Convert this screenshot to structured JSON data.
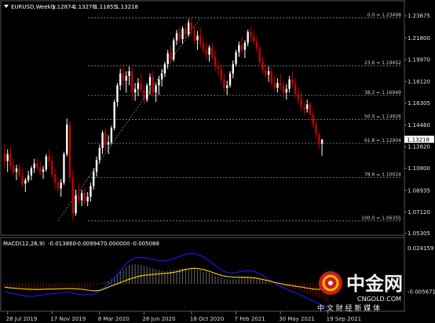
{
  "chart_header": {
    "symbol": "EURUSD,Weekly",
    "open": "1.12874",
    "high": "1.13278",
    "low": "1.11855",
    "close": "1.13218"
  },
  "macd_header": {
    "label": "MACD(12,26,9)",
    "macd": "-0.013860",
    "signal": "-0.009947",
    "hist": "0.000000",
    "extra": "-0.005088"
  },
  "current_price": "1.13218",
  "watermark": {
    "logo_text": "中金网",
    "domain": "CNGOLD.COM",
    "slogan": "中 文 财 经 新 媒 体"
  },
  "colors": {
    "background": "#000000",
    "bull": "#ffffff",
    "bear": "#cc0000",
    "fib_line": "#8c8c8c",
    "macd_hist_pos": "#d0d0d0",
    "macd_hist_neg": "#dd1111",
    "macd_line": "#1a1aff",
    "signal_line": "#ffd400",
    "frame": "#555555"
  },
  "chart_data": [
    {
      "type": "candlestick",
      "title": "EURUSD,Weekly",
      "ylim": [
        1.0535,
        1.2395
      ],
      "y_ticks": [
        "1.23675",
        "1.21800",
        "1.19970",
        "1.18120",
        "1.16305",
        "1.14460",
        "1.12620",
        "1.10800",
        "1.08935",
        "1.07120",
        "1.05305"
      ],
      "x_ticks": [
        "28 Jul 2019",
        "17 Nov 2019",
        "8 Mar 2020",
        "28 Jun 2020",
        "18 Oct 2020",
        "7 Feb 2021",
        "30 May 2021",
        "19 Sep 2021"
      ],
      "fibonacci": [
        {
          "label": "0.0 = 1.23498",
          "value": 1.23498
        },
        {
          "label": "23.6 = 1.19452",
          "value": 1.19452
        },
        {
          "label": "38.2 = 1.16949",
          "value": 1.16949
        },
        {
          "label": "50.0 = 1.14926",
          "value": 1.14926
        },
        {
          "label": "61.8 = 1.12904",
          "value": 1.12904
        },
        {
          "label": "78.6 = 1.10024",
          "value": 1.10024
        },
        {
          "label": "100.0 = 1.06355",
          "value": 1.06355
        }
      ],
      "trendline": {
        "from": [
          18,
          1.0636
        ],
        "to": [
          66,
          1.2349
        ]
      },
      "candles": [
        [
          1.12,
          1.128,
          1.108,
          1.114
        ],
        [
          1.114,
          1.124,
          1.105,
          1.12
        ],
        [
          1.12,
          1.126,
          1.107,
          1.11
        ],
        [
          1.11,
          1.116,
          1.102,
          1.105
        ],
        [
          1.105,
          1.111,
          1.098,
          1.108
        ],
        [
          1.108,
          1.112,
          1.1,
          1.102
        ],
        [
          1.102,
          1.108,
          1.092,
          1.095
        ],
        [
          1.095,
          1.1,
          1.088,
          1.098
        ],
        [
          1.098,
          1.106,
          1.096,
          1.102
        ],
        [
          1.102,
          1.11,
          1.098,
          1.108
        ],
        [
          1.108,
          1.116,
          1.104,
          1.112
        ],
        [
          1.112,
          1.117,
          1.106,
          1.109
        ],
        [
          1.109,
          1.114,
          1.102,
          1.105
        ],
        [
          1.105,
          1.11,
          1.099,
          1.107
        ],
        [
          1.107,
          1.12,
          1.105,
          1.118
        ],
        [
          1.118,
          1.124,
          1.11,
          1.114
        ],
        [
          1.114,
          1.118,
          1.1,
          1.103
        ],
        [
          1.103,
          1.108,
          1.09,
          1.096
        ],
        [
          1.096,
          1.1,
          1.088,
          1.091
        ],
        [
          1.091,
          1.099,
          1.084,
          1.096
        ],
        [
          1.096,
          1.122,
          1.094,
          1.12
        ],
        [
          1.12,
          1.15,
          1.118,
          1.145
        ],
        [
          1.145,
          1.148,
          1.096,
          1.1
        ],
        [
          1.1,
          1.106,
          1.0636,
          1.07
        ],
        [
          1.07,
          1.09,
          1.068,
          1.085
        ],
        [
          1.085,
          1.095,
          1.078,
          1.081
        ],
        [
          1.081,
          1.09,
          1.076,
          1.087
        ],
        [
          1.087,
          1.092,
          1.078,
          1.08
        ],
        [
          1.08,
          1.088,
          1.076,
          1.084
        ],
        [
          1.084,
          1.096,
          1.08,
          1.093
        ],
        [
          1.093,
          1.108,
          1.09,
          1.105
        ],
        [
          1.105,
          1.118,
          1.101,
          1.115
        ],
        [
          1.115,
          1.128,
          1.112,
          1.125
        ],
        [
          1.125,
          1.14,
          1.12,
          1.138
        ],
        [
          1.138,
          1.142,
          1.123,
          1.128
        ],
        [
          1.128,
          1.136,
          1.12,
          1.13
        ],
        [
          1.13,
          1.144,
          1.128,
          1.142
        ],
        [
          1.142,
          1.166,
          1.14,
          1.164
        ],
        [
          1.164,
          1.18,
          1.16,
          1.178
        ],
        [
          1.178,
          1.192,
          1.174,
          1.188
        ],
        [
          1.188,
          1.196,
          1.176,
          1.182
        ],
        [
          1.182,
          1.19,
          1.172,
          1.186
        ],
        [
          1.186,
          1.194,
          1.178,
          1.19
        ],
        [
          1.19,
          1.193,
          1.166,
          1.172
        ],
        [
          1.172,
          1.18,
          1.165,
          1.175
        ],
        [
          1.175,
          1.184,
          1.169,
          1.18
        ],
        [
          1.18,
          1.188,
          1.172,
          1.174
        ],
        [
          1.174,
          1.178,
          1.162,
          1.166
        ],
        [
          1.166,
          1.18,
          1.164,
          1.178
        ],
        [
          1.178,
          1.188,
          1.17,
          1.185
        ],
        [
          1.185,
          1.19,
          1.168,
          1.172
        ],
        [
          1.172,
          1.18,
          1.164,
          1.178
        ],
        [
          1.178,
          1.186,
          1.17,
          1.183
        ],
        [
          1.183,
          1.192,
          1.177,
          1.188
        ],
        [
          1.188,
          1.198,
          1.185,
          1.196
        ],
        [
          1.196,
          1.208,
          1.192,
          1.205
        ],
        [
          1.205,
          1.212,
          1.196,
          1.2
        ],
        [
          1.2,
          1.218,
          1.198,
          1.216
        ],
        [
          1.216,
          1.225,
          1.212,
          1.222
        ],
        [
          1.222,
          1.227,
          1.214,
          1.217
        ],
        [
          1.217,
          1.228,
          1.213,
          1.226
        ],
        [
          1.226,
          1.23,
          1.218,
          1.221
        ],
        [
          1.221,
          1.234,
          1.219,
          1.231
        ],
        [
          1.231,
          1.235,
          1.22,
          1.224
        ],
        [
          1.224,
          1.228,
          1.213,
          1.216
        ],
        [
          1.216,
          1.224,
          1.208,
          1.22
        ],
        [
          1.22,
          1.227,
          1.21,
          1.213
        ],
        [
          1.213,
          1.219,
          1.205,
          1.208
        ],
        [
          1.208,
          1.214,
          1.199,
          1.204
        ],
        [
          1.204,
          1.212,
          1.198,
          1.21
        ],
        [
          1.21,
          1.214,
          1.2,
          1.202
        ],
        [
          1.202,
          1.208,
          1.19,
          1.194
        ],
        [
          1.194,
          1.199,
          1.186,
          1.192
        ],
        [
          1.192,
          1.196,
          1.18,
          1.183
        ],
        [
          1.183,
          1.188,
          1.172,
          1.176
        ],
        [
          1.176,
          1.182,
          1.17,
          1.178
        ],
        [
          1.178,
          1.19,
          1.176,
          1.188
        ],
        [
          1.188,
          1.199,
          1.184,
          1.196
        ],
        [
          1.196,
          1.208,
          1.194,
          1.206
        ],
        [
          1.206,
          1.215,
          1.202,
          1.212
        ],
        [
          1.212,
          1.219,
          1.205,
          1.208
        ],
        [
          1.208,
          1.216,
          1.201,
          1.214
        ],
        [
          1.214,
          1.225,
          1.211,
          1.223
        ],
        [
          1.223,
          1.227,
          1.215,
          1.219
        ],
        [
          1.219,
          1.224,
          1.212,
          1.215
        ],
        [
          1.215,
          1.22,
          1.206,
          1.209
        ],
        [
          1.209,
          1.212,
          1.195,
          1.198
        ],
        [
          1.198,
          1.202,
          1.188,
          1.191
        ],
        [
          1.191,
          1.196,
          1.184,
          1.187
        ],
        [
          1.187,
          1.194,
          1.181,
          1.19
        ],
        [
          1.19,
          1.193,
          1.178,
          1.18
        ],
        [
          1.18,
          1.186,
          1.173,
          1.176
        ],
        [
          1.176,
          1.184,
          1.172,
          1.18
        ],
        [
          1.18,
          1.188,
          1.174,
          1.178
        ],
        [
          1.178,
          1.182,
          1.168,
          1.172
        ],
        [
          1.172,
          1.179,
          1.166,
          1.175
        ],
        [
          1.175,
          1.186,
          1.172,
          1.183
        ],
        [
          1.183,
          1.19,
          1.176,
          1.179
        ],
        [
          1.179,
          1.184,
          1.168,
          1.171
        ],
        [
          1.171,
          1.176,
          1.162,
          1.166
        ],
        [
          1.166,
          1.172,
          1.156,
          1.16
        ],
        [
          1.16,
          1.164,
          1.153,
          1.158
        ],
        [
          1.158,
          1.166,
          1.155,
          1.162
        ],
        [
          1.162,
          1.164,
          1.15,
          1.153
        ],
        [
          1.153,
          1.157,
          1.142,
          1.145
        ],
        [
          1.145,
          1.149,
          1.133,
          1.137
        ],
        [
          1.137,
          1.139,
          1.124,
          1.129
        ],
        [
          1.1287,
          1.1328,
          1.1186,
          1.1322
        ]
      ]
    },
    {
      "type": "line",
      "title": "MACD(12,26,9)",
      "ylim": [
        -0.0185,
        0.0245
      ],
      "y_ticks": [
        "0.024159",
        "-0.005671"
      ],
      "series": [
        {
          "name": "histogram",
          "values": [
            -0.003,
            -0.0032,
            -0.0035,
            -0.0038,
            -0.004,
            -0.0043,
            -0.0045,
            -0.0047,
            -0.0048,
            -0.0048,
            -0.0046,
            -0.0043,
            -0.004,
            -0.0038,
            -0.0036,
            -0.0034,
            -0.0033,
            -0.0031,
            -0.003,
            -0.0028,
            -0.0026,
            -0.002,
            -0.0025,
            -0.003,
            -0.0034,
            -0.0036,
            -0.0036,
            -0.0035,
            -0.0032,
            -0.0028,
            -0.0022,
            -0.0014,
            -0.0005,
            0.0004,
            0.0012,
            0.002,
            0.003,
            0.0045,
            0.0062,
            0.008,
            0.0098,
            0.0112,
            0.0124,
            0.013,
            0.0132,
            0.013,
            0.0126,
            0.012,
            0.0115,
            0.011,
            0.0104,
            0.0098,
            0.0092,
            0.0088,
            0.0086,
            0.0088,
            0.009,
            0.0094,
            0.0098,
            0.0101,
            0.0103,
            0.0104,
            0.0104,
            0.0103,
            0.01,
            0.0096,
            0.0092,
            0.0086,
            0.008,
            0.0072,
            0.0064,
            0.0055,
            0.0046,
            0.0038,
            0.0032,
            0.0028,
            0.0026,
            0.0028,
            0.0032,
            0.0036,
            0.004,
            0.0043,
            0.0045,
            0.0045,
            0.0043,
            0.004,
            0.0034,
            0.0026,
            0.0018,
            0.001,
            0.0002,
            -0.0006,
            -0.0013,
            -0.002,
            -0.0026,
            -0.0031,
            -0.0036,
            -0.004,
            -0.0045,
            -0.005,
            -0.0056,
            -0.0062,
            -0.0068,
            -0.0075,
            -0.0082,
            -0.009,
            -0.01,
            -0.0112,
            -0.0124,
            -0.0134
          ]
        },
        {
          "name": "macd",
          "values": [
            -0.0055,
            -0.006,
            -0.0065,
            -0.007,
            -0.0074,
            -0.0078,
            -0.0082,
            -0.0085,
            -0.0087,
            -0.0088,
            -0.0087,
            -0.0084,
            -0.0081,
            -0.0078,
            -0.0075,
            -0.0073,
            -0.0071,
            -0.0069,
            -0.0067,
            -0.0065,
            -0.0062,
            -0.0055,
            -0.006,
            -0.0066,
            -0.0071,
            -0.0074,
            -0.0076,
            -0.0077,
            -0.0077,
            -0.0076,
            -0.0072,
            -0.0064,
            -0.0052,
            -0.0038,
            -0.0022,
            -0.0005,
            0.0014,
            0.0036,
            0.006,
            0.0086,
            0.0112,
            0.0134,
            0.0153,
            0.0166,
            0.0174,
            0.0178,
            0.0178,
            0.0176,
            0.0173,
            0.017,
            0.0166,
            0.0162,
            0.0158,
            0.0155,
            0.0155,
            0.0158,
            0.0163,
            0.017,
            0.0178,
            0.0186,
            0.0194,
            0.02,
            0.0204,
            0.0206,
            0.0204,
            0.0199,
            0.0192,
            0.0182,
            0.017,
            0.0156,
            0.014,
            0.0124,
            0.0108,
            0.0094,
            0.0083,
            0.0076,
            0.0072,
            0.0072,
            0.0075,
            0.0079,
            0.0083,
            0.0086,
            0.0087,
            0.0086,
            0.0082,
            0.0076,
            0.0066,
            0.0054,
            0.0041,
            0.0028,
            0.0015,
            0.0002,
            -0.001,
            -0.0021,
            -0.0031,
            -0.004,
            -0.0048,
            -0.0056,
            -0.0064,
            -0.0072,
            -0.008,
            -0.009,
            -0.01,
            -0.011,
            -0.012,
            -0.013,
            -0.014,
            -0.015,
            -0.016,
            -0.017
          ]
        },
        {
          "name": "signal",
          "values": [
            -0.0025,
            -0.0028,
            -0.003,
            -0.0032,
            -0.0034,
            -0.0035,
            -0.0037,
            -0.0038,
            -0.0039,
            -0.004,
            -0.0041,
            -0.0041,
            -0.0041,
            -0.004,
            -0.0039,
            -0.0039,
            -0.0038,
            -0.0038,
            -0.0037,
            -0.0037,
            -0.0036,
            -0.0035,
            -0.0035,
            -0.0036,
            -0.0037,
            -0.0038,
            -0.004,
            -0.0042,
            -0.0045,
            -0.0048,
            -0.005,
            -0.005,
            -0.0047,
            -0.0042,
            -0.0034,
            -0.0025,
            -0.0016,
            -0.0009,
            -0.0002,
            0.0006,
            0.0014,
            0.0022,
            0.0029,
            0.0036,
            0.0042,
            0.0048,
            0.0052,
            0.0056,
            0.0058,
            0.006,
            0.0062,
            0.0064,
            0.0066,
            0.0067,
            0.0069,
            0.007,
            0.0073,
            0.0076,
            0.008,
            0.0085,
            0.0091,
            0.0096,
            0.01,
            0.0103,
            0.0104,
            0.0103,
            0.01,
            0.0096,
            0.009,
            0.0084,
            0.0076,
            0.0069,
            0.0062,
            0.0056,
            0.0051,
            0.0048,
            0.0046,
            0.0044,
            0.0043,
            0.0043,
            0.0043,
            0.0043,
            0.0042,
            0.0041,
            0.0039,
            0.0036,
            0.0032,
            0.0028,
            0.0023,
            0.0018,
            0.0013,
            0.0008,
            0.0003,
            -0.0001,
            -0.0005,
            -0.0009,
            -0.0012,
            -0.0016,
            -0.0019,
            -0.0022,
            -0.0024,
            -0.0028,
            -0.0032,
            -0.0035,
            -0.0038,
            -0.004,
            -0.004,
            -0.0038,
            -0.0036,
            -0.0036
          ]
        }
      ]
    }
  ]
}
